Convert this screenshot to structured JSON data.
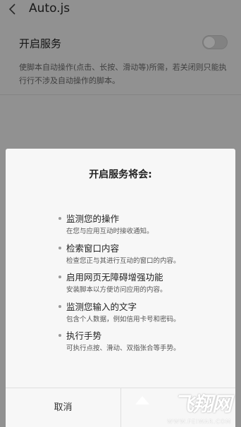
{
  "header": {
    "back_icon": "chevron-left-icon",
    "title": "Auto.js"
  },
  "setting": {
    "label": "开启服务",
    "toggle_on": false,
    "description": "使脚本自动操作(点击、长按、滑动等)所需，若关闭则只能执行行不涉及自动操作的脚本。"
  },
  "dialog": {
    "title": "开启服务将会:",
    "permissions": [
      {
        "title": "监测您的操作",
        "desc": "在您与应用互动时接收通知。"
      },
      {
        "title": "检索窗口内容",
        "desc": "检查您正与其进行互动的窗口的内容。"
      },
      {
        "title": "启用网页无障碍增强功能",
        "desc": "安装脚本以方便访问应用的内容。"
      },
      {
        "title": "监测您输入的文字",
        "desc": "包含个人数据，例如信用卡号和密码。"
      },
      {
        "title": "执行手势",
        "desc": "可执行点按、滑动、双指张合等手势。"
      }
    ],
    "cancel_label": "取消",
    "ok_label": ""
  },
  "watermark": {
    "main": "飞翔网",
    "sub": "WWW.FEIWAR.COM"
  },
  "colors": {
    "background": "#f2f2f2",
    "dialog": "#f7f7f7",
    "divider": "#dedede"
  }
}
